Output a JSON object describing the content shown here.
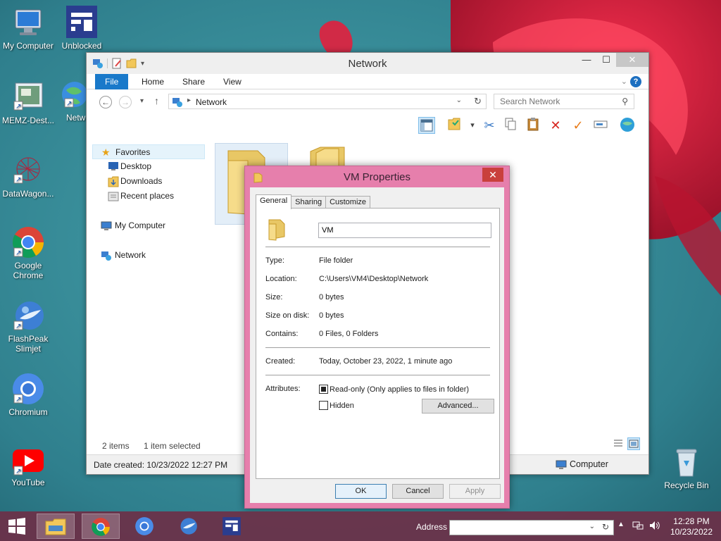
{
  "desktop": {
    "icons": [
      {
        "label": "My Computer",
        "icon": "computer-icon"
      },
      {
        "label": "Unblocked",
        "icon": "unblocked-app-icon"
      },
      {
        "label": "MEMZ-Dest...",
        "icon": "memz-icon"
      },
      {
        "label": "Netw",
        "icon": "network-globe-icon"
      },
      {
        "label": "DataWagon...",
        "icon": "datawagon-icon"
      },
      {
        "label": "Google Chrome",
        "icon": "chrome-icon"
      },
      {
        "label": "FlashPeak Slimjet",
        "icon": "slimjet-icon"
      },
      {
        "label": "Chromium",
        "icon": "chromium-icon"
      },
      {
        "label": "YouTube",
        "icon": "youtube-icon"
      },
      {
        "label": "Recycle Bin",
        "icon": "recycle-bin-icon"
      }
    ]
  },
  "explorer": {
    "title": "Network",
    "ribbon_tabs": [
      "File",
      "Home",
      "Share",
      "View"
    ],
    "address": {
      "crumb": "Network"
    },
    "search": {
      "placeholder": "Search Network"
    },
    "nav": {
      "favorites": "Favorites",
      "favorites_items": [
        "Desktop",
        "Downloads",
        "Recent places"
      ],
      "my_computer": "My Computer",
      "network": "Network"
    },
    "status": {
      "items": "2 items",
      "selected": "1 item selected"
    },
    "details": {
      "date_created": "Date created: 10/23/2022 12:27 PM",
      "location": "Computer"
    }
  },
  "properties": {
    "title": "VM Properties",
    "tabs": [
      "General",
      "Sharing",
      "Customize"
    ],
    "name_value": "VM",
    "fields": {
      "type_label": "Type:",
      "type_value": "File folder",
      "location_label": "Location:",
      "location_value": "C:\\Users\\VM4\\Desktop\\Network",
      "size_label": "Size:",
      "size_value": "0 bytes",
      "size_on_disk_label": "Size on disk:",
      "size_on_disk_value": "0 bytes",
      "contains_label": "Contains:",
      "contains_value": "0 Files, 0 Folders",
      "created_label": "Created:",
      "created_value": "Today, October 23, 2022, 1 minute ago",
      "attributes_label": "Attributes:"
    },
    "attributes": {
      "readonly_label": "Read-only (Only applies to files in folder)",
      "hidden_label": "Hidden",
      "advanced_button": "Advanced..."
    },
    "buttons": {
      "ok": "OK",
      "cancel": "Cancel",
      "apply": "Apply"
    }
  },
  "taskbar": {
    "address_label": "Address",
    "time": "12:28 PM",
    "date": "10/23/2022"
  }
}
